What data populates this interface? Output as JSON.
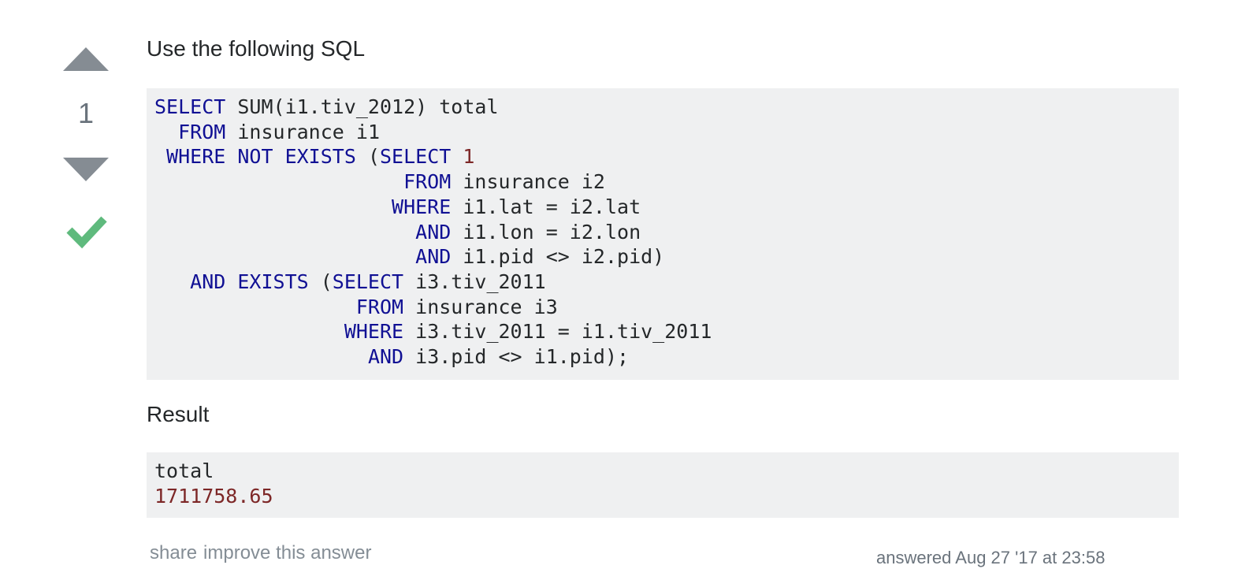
{
  "vote": {
    "count": "1",
    "up_icon": "upvote-arrow-icon",
    "down_icon": "downvote-arrow-icon",
    "accepted_icon": "accepted-checkmark-icon",
    "arrow_color": "#858c93",
    "accepted_color": "#5fba7d"
  },
  "answer": {
    "intro": "Use the following SQL",
    "sql": {
      "l1": {
        "kw": "SELECT",
        "rest": " SUM(i1.tiv_2012) total"
      },
      "l2": {
        "indent": "  ",
        "kw": "FROM",
        "rest": " insurance i1"
      },
      "l3": {
        "indent": " ",
        "kw": "WHERE NOT EXISTS",
        "mid": " (",
        "kw2": "SELECT",
        "sp": " ",
        "num": "1"
      },
      "l4": {
        "indent": "                     ",
        "kw": "FROM",
        "rest": " insurance i2"
      },
      "l5": {
        "indent": "                    ",
        "kw": "WHERE",
        "rest": " i1.lat = i2.lat"
      },
      "l6": {
        "indent": "                      ",
        "kw": "AND",
        "rest": " i1.lon = i2.lon"
      },
      "l7": {
        "indent": "                      ",
        "kw": "AND",
        "rest": " i1.pid <> i2.pid)"
      },
      "l8": {
        "indent": "   ",
        "kw": "AND EXISTS",
        "mid": " (",
        "kw2": "SELECT",
        "rest": " i3.tiv_2011"
      },
      "l9": {
        "indent": "                 ",
        "kw": "FROM",
        "rest": " insurance i3"
      },
      "l10": {
        "indent": "                ",
        "kw": "WHERE",
        "rest": " i3.tiv_2011 = i1.tiv_2011"
      },
      "l11": {
        "indent": "                  ",
        "kw": "AND",
        "rest": " i3.pid <> i1.pid);"
      }
    },
    "result_label": "Result",
    "result": {
      "header": "total",
      "value": "1711758.65"
    }
  },
  "menu": {
    "share": "share",
    "improve": "improve this answer"
  },
  "user_action": "answered Aug 27 '17 at 23:58"
}
